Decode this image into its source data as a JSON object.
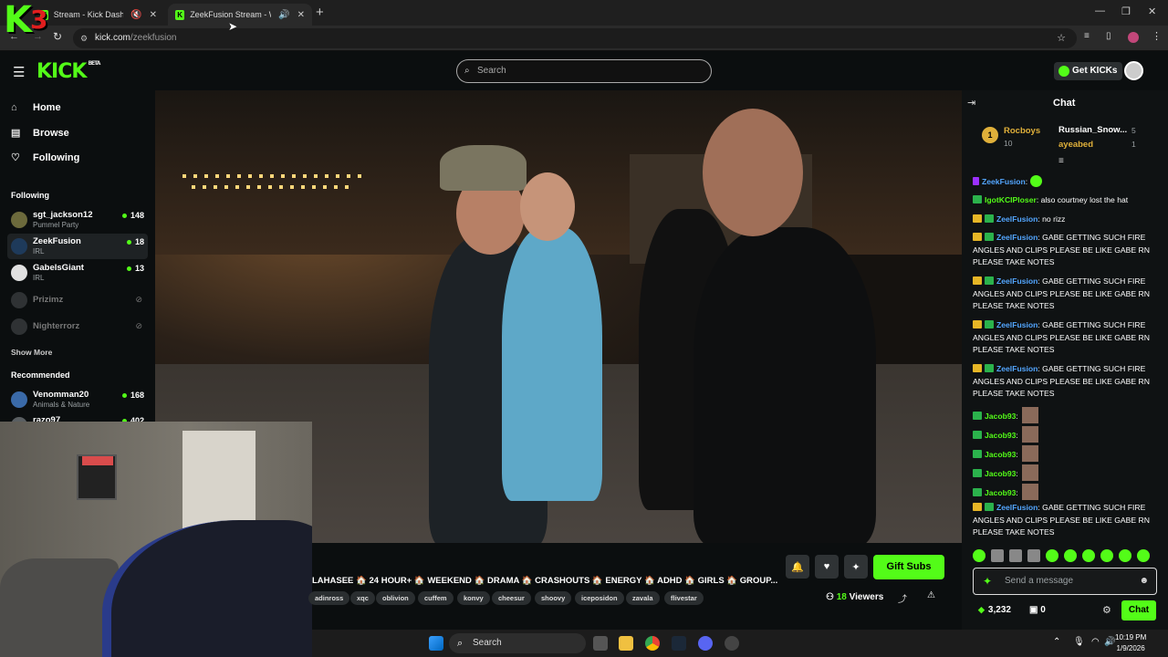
{
  "browser": {
    "tabs": [
      {
        "title": "Stream - Kick Dashboard",
        "active": false
      },
      {
        "title": "ZeekFusion Stream - Watch",
        "active": true
      }
    ],
    "url_host": "kick.com",
    "url_path": "/zeekfusion"
  },
  "overlay_logo": {
    "letter": "K",
    "number": "3"
  },
  "header": {
    "logo": "KICK",
    "logo_sup": "BETA",
    "search_placeholder": "Search",
    "get_kicks_label": "Get KICKs"
  },
  "sidebar": {
    "nav": [
      {
        "label": "Home",
        "icon": "home-icon"
      },
      {
        "label": "Browse",
        "icon": "browse-icon"
      },
      {
        "label": "Following",
        "icon": "heart-icon"
      }
    ],
    "following_heading": "Following",
    "following": [
      {
        "name": "sgt_jackson12",
        "category": "Pummel Party",
        "viewers": "148",
        "live": true
      },
      {
        "name": "ZeekFusion",
        "category": "IRL",
        "viewers": "18",
        "live": true,
        "selected": true
      },
      {
        "name": "GabelsGiant",
        "category": "IRL",
        "viewers": "13",
        "live": true
      },
      {
        "name": "Prizimz",
        "live": false
      },
      {
        "name": "Nighterrorz",
        "live": false
      }
    ],
    "show_more": "Show More",
    "recommended_heading": "Recommended",
    "recommended": [
      {
        "name": "Venomman20",
        "category": "Animals & Nature",
        "viewers": "168"
      },
      {
        "name": "razo97",
        "category": "",
        "viewers": "402"
      }
    ]
  },
  "stream": {
    "title": "LAHASEE 🏠 24 HOUR+ 🏠 WEEKEND 🏠 DRAMA 🏠 CRASHOUTS 🏠 ENERGY 🏠 ADHD 🏠 GIRLS 🏠 GROUP...",
    "tags": [
      "adinross",
      "xqc",
      "oblivion",
      "cuffem",
      "konvy",
      "cheesur",
      "shoovy",
      "iceposidon",
      "zavala",
      "flivestar"
    ],
    "viewers_count": "18",
    "viewers_label": "Viewers",
    "gift_subs_label": "Gift Subs"
  },
  "chat": {
    "title": "Chat",
    "leaderboard": [
      {
        "rank": "1",
        "name": "Rocboys",
        "value": "10"
      },
      {
        "name": "Russian_Snow...",
        "value": "5"
      },
      {
        "name": "ayeabed",
        "value": "1"
      }
    ],
    "messages": [
      {
        "user": "ZeekFusion",
        "text": "",
        "color": "#53a6ff"
      },
      {
        "user": "IgotKCIPloser",
        "text": "also courtney lost the hat",
        "color": "#53fc18"
      },
      {
        "user": "ZeelFusion",
        "text": "no rizz",
        "color": "#53a6ff"
      },
      {
        "user": "ZeelFusion",
        "text": "GABE GETTING SUCH FIRE ANGLES AND CLIPS PLEASE BE LIKE GABE RN PLEASE TAKE NOTES",
        "color": "#53a6ff"
      },
      {
        "user": "ZeelFusion",
        "text": "GABE GETTING SUCH FIRE ANGLES AND CLIPS PLEASE BE LIKE GABE RN PLEASE TAKE NOTES",
        "color": "#53a6ff"
      },
      {
        "user": "ZeelFusion",
        "text": "GABE GETTING SUCH FIRE ANGLES AND CLIPS PLEASE BE LIKE GABE RN PLEASE TAKE NOTES",
        "color": "#53a6ff"
      },
      {
        "user": "ZeelFusion",
        "text": "GABE GETTING SUCH FIRE ANGLES AND CLIPS PLEASE BE LIKE GABE RN PLEASE TAKE NOTES",
        "color": "#53a6ff"
      },
      {
        "user": "Jacob93",
        "text": "",
        "color": "#53fc18"
      },
      {
        "user": "Jacob93",
        "text": "",
        "color": "#53fc18"
      },
      {
        "user": "Jacob93",
        "text": "",
        "color": "#53fc18"
      },
      {
        "user": "Jacob93",
        "text": "",
        "color": "#53fc18"
      },
      {
        "user": "Jacob93",
        "text": "",
        "color": "#53fc18"
      },
      {
        "user": "ZeelFusion",
        "text": "GABE GETTING SUCH FIRE ANGLES AND CLIPS PLEASE BE LIKE GABE RN PLEASE TAKE NOTES",
        "color": "#53a6ff"
      }
    ],
    "send_placeholder": "Send a message",
    "kicks_count": "3,232",
    "subs_count": "0",
    "chat_button": "Chat"
  },
  "taskbar": {
    "search_label": "Search",
    "time": "10:19 PM",
    "date": "1/9/2026"
  },
  "colors": {
    "accent": "#53fc18",
    "background": "#0b0e0f"
  }
}
